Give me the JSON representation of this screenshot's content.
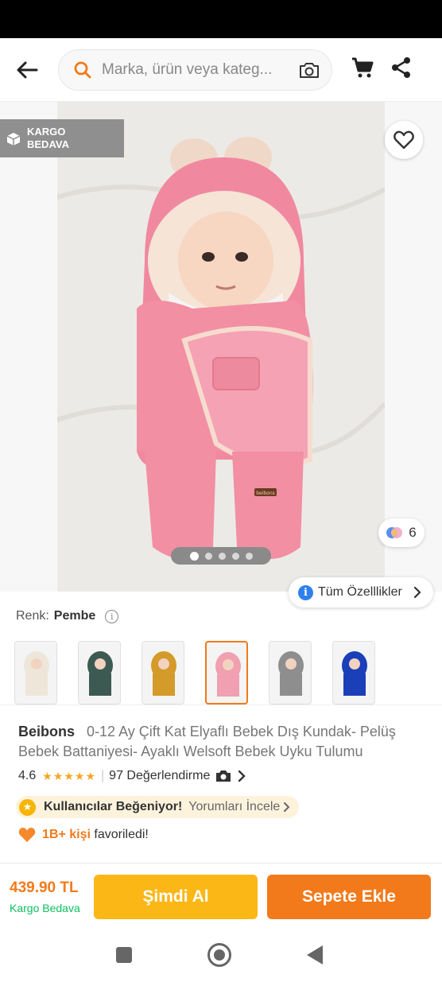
{
  "header": {
    "search_placeholder": "Marka, ürün veya kateg...",
    "icons": [
      "back-arrow-icon",
      "search-icon",
      "camera-icon",
      "cart-icon",
      "share-icon"
    ]
  },
  "gallery": {
    "kargo_badge_line1": "KARGO",
    "kargo_badge_line2": "BEDAVA",
    "color_count": "6",
    "image_count": 5,
    "active_image_index": 0,
    "all_features_label": "Tüm Özelllikler",
    "product_tag": "beibons"
  },
  "color": {
    "label": "Renk:",
    "value": "Pembe",
    "variants": [
      {
        "name": "krem",
        "color": "#efe6da"
      },
      {
        "name": "yeşil",
        "color": "#3d5a52"
      },
      {
        "name": "hardal",
        "color": "#d49a2a"
      },
      {
        "name": "pembe",
        "color": "#f0a0b0",
        "selected": true
      },
      {
        "name": "gri",
        "color": "#8e8e8e"
      },
      {
        "name": "mavi",
        "color": "#1b3fb8"
      }
    ]
  },
  "product": {
    "brand": "Beibons",
    "title": "0-12 Ay Çift Kat Elyaflı Bebek Dış Kundak- Pelüş Bebek Battaniyesi- Ayaklı Welsoft Bebek Uyku Tulumu",
    "rating": "4.6",
    "stars": "★★★★★",
    "reviews": "97 Değerlendirme",
    "liked_label": "Kullanıcılar Beğeniyor!",
    "reviews_link": "Yorumları İncele",
    "fav_count": "1B+ kişi",
    "fav_suffix": "favoriledi!"
  },
  "purchase": {
    "price": "439.90 TL",
    "shipping": "Kargo Bedava",
    "buy_now": "Şimdi Al",
    "add_to_cart": "Sepete Ekle"
  },
  "colors": {
    "accent": "#f27a1a",
    "buy_now": "#fbb716",
    "shipping_green": "#0bc15c",
    "link_blue": "#2f80ed"
  }
}
